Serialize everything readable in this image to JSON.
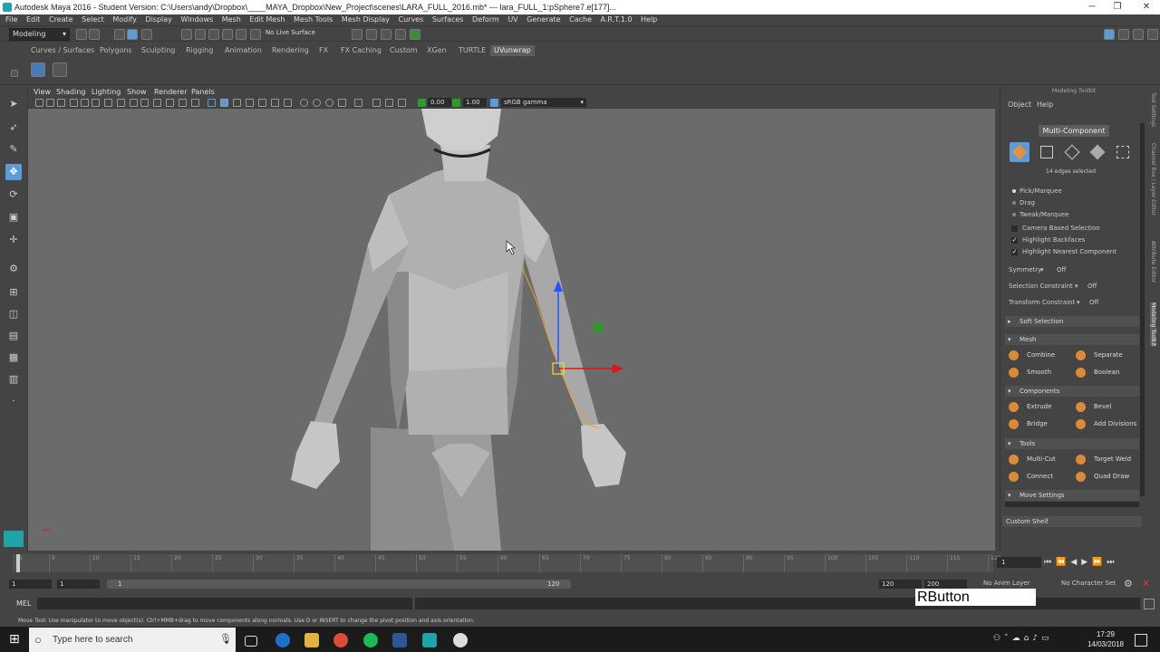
{
  "window": {
    "title": "Autodesk Maya 2016 - Student Version: C:\\Users\\andy\\Dropbox\\____MAYA_Dropbox\\New_Project\\scenes\\LARA_FULL_2016.mb*   ---   lara_FULL_1:pSphere7.e[177]...",
    "minimize": "─",
    "maximize": "❐",
    "close": "✕"
  },
  "menu": [
    "File",
    "Edit",
    "Create",
    "Select",
    "Modify",
    "Display",
    "Windows",
    "Mesh",
    "Edit Mesh",
    "Mesh Tools",
    "Mesh Display",
    "Curves",
    "Surfaces",
    "Deform",
    "UV",
    "Generate",
    "Cache",
    "A.R.T.1.0",
    "Help"
  ],
  "statusline": {
    "menuset": "Modeling",
    "live_surface": "No Live Surface"
  },
  "shelf_tabs": [
    "Curves / Surfaces",
    "Polygons",
    "Sculpting",
    "Rigging",
    "Animation",
    "Rendering",
    "FX",
    "FX Caching",
    "Custom",
    "XGen",
    "TURTLE",
    "UVunwrap"
  ],
  "active_shelf": "UVunwrap",
  "viewport": {
    "menus": [
      "View",
      "Shading",
      "Lighting",
      "Show",
      "Renderer",
      "Panels"
    ],
    "exposure": "0.00",
    "gamma": "1.00",
    "color_space": "sRGB gamma",
    "camera_label": "persp"
  },
  "modeling_toolkit": {
    "header": "Modeling Toolkit",
    "tabs": [
      "Object",
      "Help"
    ],
    "mode_title": "Multi-Component",
    "selection_info": "14 edges selected",
    "selection_modes": [
      "Pick/Marquee",
      "Drag",
      "Tweak/Marquee"
    ],
    "options": [
      {
        "label": "Camera Based Selection",
        "checked": false
      },
      {
        "label": "Highlight Backfaces",
        "checked": true
      },
      {
        "label": "Highlight Nearest Component",
        "checked": true
      }
    ],
    "symmetry": {
      "label": "Symmetry",
      "value": "Off"
    },
    "selection_constraint": {
      "label": "Selection Constraint",
      "value": "Off"
    },
    "transform_constraint": {
      "label": "Transform Constraint",
      "value": "Off"
    },
    "soft_selection": "Soft Selection",
    "sections": {
      "mesh": {
        "title": "Mesh",
        "buttons": [
          "Combine",
          "Separate",
          "Smooth",
          "Boolean"
        ]
      },
      "components": {
        "title": "Components",
        "buttons": [
          "Extrude",
          "Bevel",
          "Bridge",
          "Add Divisions"
        ]
      },
      "tools": {
        "title": "Tools",
        "buttons": [
          "Multi-Cut",
          "Target Weld",
          "Connect",
          "Quad Draw"
        ]
      }
    },
    "move_settings": "Move Settings",
    "custom_shelf": "Custom Shelf"
  },
  "side_tabs": [
    "Tool Settings",
    "Channel Box / Layer Editor",
    "Attribute Editor",
    "Modeling Toolkit"
  ],
  "timeline": {
    "ticks": [
      "1",
      "5",
      "10",
      "15",
      "20",
      "25",
      "30",
      "35",
      "40",
      "45",
      "50",
      "55",
      "60",
      "65",
      "70",
      "75",
      "80",
      "85",
      "90",
      "95",
      "100",
      "105",
      "110",
      "115",
      "120"
    ],
    "current_frame": "1"
  },
  "range": {
    "start": "1",
    "playback_start": "1",
    "slider_start": "1",
    "slider_end": "120",
    "playback_end": "120",
    "end": "200",
    "anim_layer": "No Anim Layer",
    "character_set": "No Character Set"
  },
  "command_line": {
    "label": "MEL"
  },
  "overlay_text": "RButton",
  "help_line": "Move Tool: Use manipulator to move object(s). Ctrl+MMB+drag to move components along normals. Use D or INSERT to change the pivot position and axis orientation.",
  "taskbar": {
    "search_placeholder": "Type here to search",
    "time": "17:29",
    "date": "14/03/2018"
  },
  "colors": {
    "accent_blue": "#5d9ad8",
    "toolkit_orange": "#d98a3a",
    "selection_edge": "#f0a030",
    "manip_y": "#2255ff",
    "manip_x": "#e01515",
    "manip_center": "#f0e030",
    "manip_z": "#2a9a2a"
  }
}
